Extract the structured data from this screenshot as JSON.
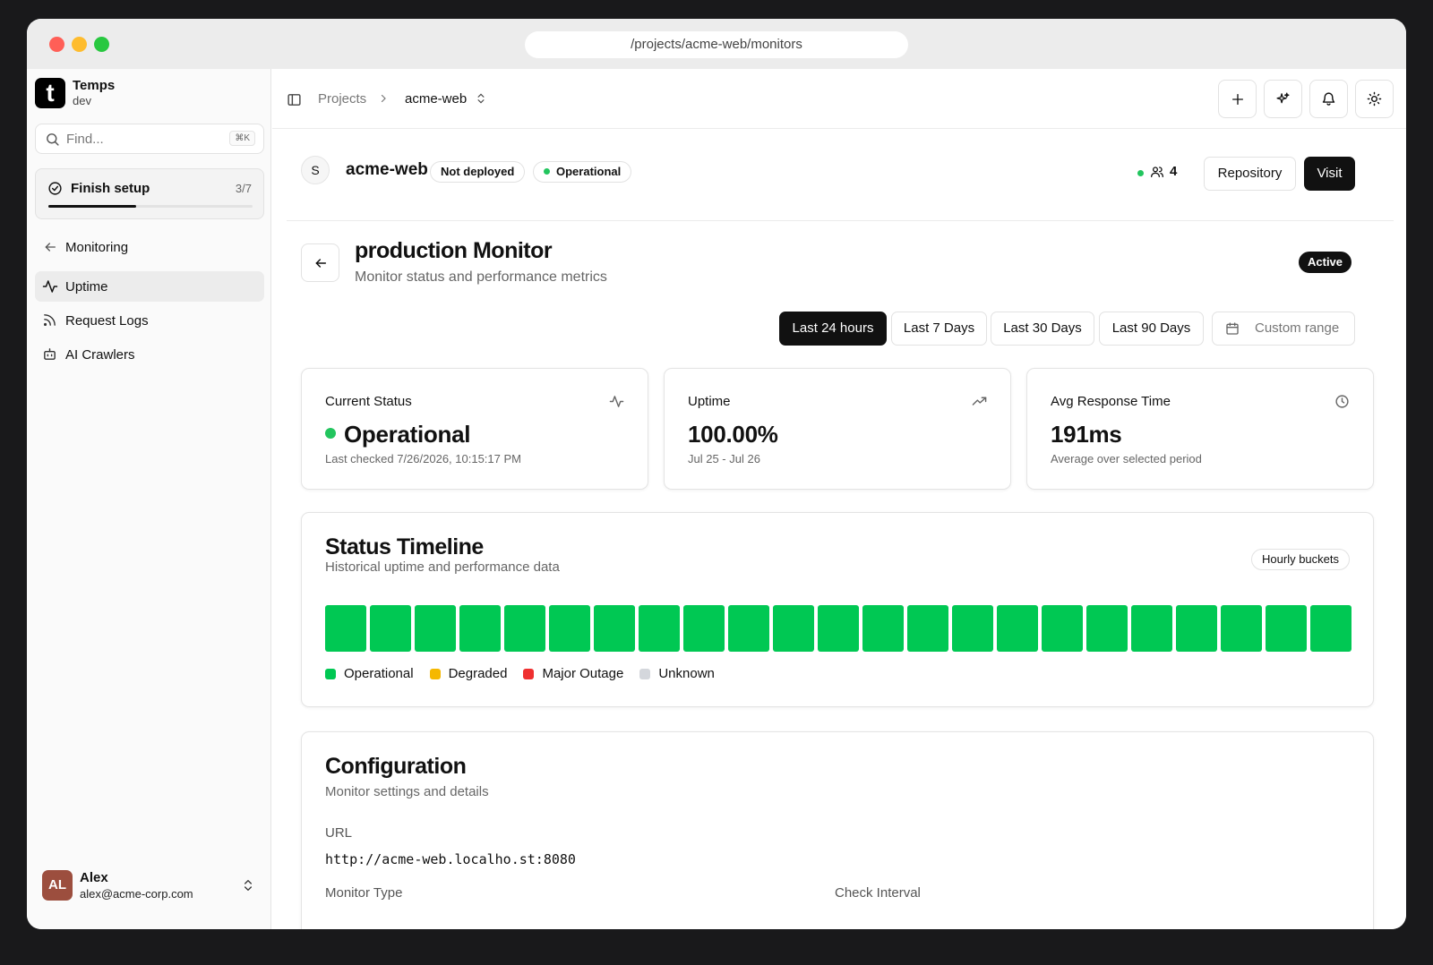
{
  "browser": {
    "url": "/projects/acme-web/monitors"
  },
  "sidebar": {
    "logo_letter": "t",
    "app_name": "Temps",
    "env": "dev",
    "search_placeholder": "Find...",
    "search_shortcut": "⌘K",
    "setup": {
      "label": "Finish setup",
      "count": "3/7",
      "progress": 0.43
    },
    "back_label": "Monitoring",
    "items": [
      {
        "label": "Uptime",
        "icon": "activity-icon",
        "active": true
      },
      {
        "label": "Request Logs",
        "icon": "rss-icon",
        "active": false
      },
      {
        "label": "AI Crawlers",
        "icon": "bot-icon",
        "active": false
      }
    ],
    "user": {
      "initials": "AL",
      "name": "Alex",
      "email": "alex@acme-corp.com"
    }
  },
  "topbar": {
    "crumb_root": "Projects",
    "crumb_project": "acme-web"
  },
  "project": {
    "avatar_letter": "S",
    "name": "acme-web",
    "deploy_badge": "Not deployed",
    "status_badge": "Operational",
    "member_count": "4",
    "repo_button": "Repository",
    "visit_button": "Visit"
  },
  "monitor": {
    "title": "production Monitor",
    "subtitle": "Monitor status and performance metrics",
    "state": "Active",
    "ranges": [
      "Last 24 hours",
      "Last 7 Days",
      "Last 30 Days",
      "Last 90 Days"
    ],
    "custom_range": "Custom range"
  },
  "cards": {
    "status": {
      "label": "Current Status",
      "value": "Operational",
      "sub": "Last checked 7/26/2026, 10:15:17 PM"
    },
    "uptime": {
      "label": "Uptime",
      "value": "100.00%",
      "sub": "Jul 25 - Jul 26"
    },
    "response": {
      "label": "Avg Response Time",
      "value": "191ms",
      "sub": "Average over selected period"
    }
  },
  "timeline": {
    "title": "Status Timeline",
    "subtitle": "Historical uptime and performance data",
    "bucket_badge": "Hourly buckets",
    "buckets": [
      "operational",
      "operational",
      "operational",
      "operational",
      "operational",
      "operational",
      "operational",
      "operational",
      "operational",
      "operational",
      "operational",
      "operational",
      "operational",
      "operational",
      "operational",
      "operational",
      "operational",
      "operational",
      "operational",
      "operational",
      "operational",
      "operational",
      "operational"
    ],
    "legend": [
      {
        "label": "Operational",
        "color": "#00c853"
      },
      {
        "label": "Degraded",
        "color": "#f5b800"
      },
      {
        "label": "Major Outage",
        "color": "#ef3030"
      },
      {
        "label": "Unknown",
        "color": "#d4d7dc"
      }
    ]
  },
  "config": {
    "title": "Configuration",
    "subtitle": "Monitor settings and details",
    "url_label": "URL",
    "url_value": "http://acme-web.localho.st:8080",
    "type_label": "Monitor Type",
    "interval_label": "Check Interval"
  }
}
